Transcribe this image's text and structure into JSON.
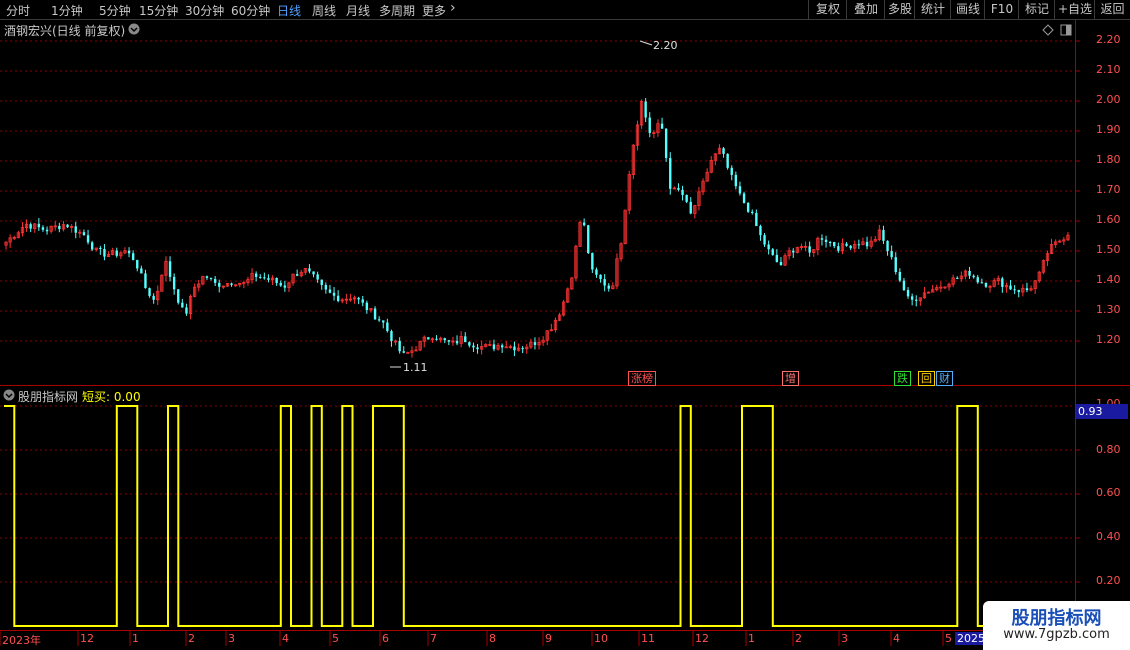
{
  "toolbar": {
    "periods": [
      {
        "label": "分时",
        "active": false
      },
      {
        "label": "1分钟",
        "active": false
      },
      {
        "label": "5分钟",
        "active": false
      },
      {
        "label": "15分钟",
        "active": false
      },
      {
        "label": "30分钟",
        "active": false
      },
      {
        "label": "60分钟",
        "active": false
      },
      {
        "label": "日线",
        "active": true
      },
      {
        "label": "周线",
        "active": false
      },
      {
        "label": "月线",
        "active": false
      },
      {
        "label": "多周期",
        "active": false
      },
      {
        "label": "更多",
        "active": false
      }
    ],
    "more_arrow": "›",
    "right_buttons": [
      "复权",
      "叠加",
      "多股",
      "统计",
      "画线",
      "F10",
      "标记",
      "+自选",
      "返回"
    ]
  },
  "price_panel": {
    "title": "酒钢宏兴(日线 前复权)",
    "y_axis_labels": [
      "2.20",
      "2.10",
      "2.00",
      "1.90",
      "1.80",
      "1.70",
      "1.60",
      "1.50",
      "1.40",
      "1.30",
      "1.20"
    ],
    "high_label": "2.20",
    "low_label": "1.11",
    "events": [
      "涨榜",
      "增",
      "跌",
      "回",
      "财"
    ]
  },
  "indicator_panel": {
    "name": "股朋指标网",
    "series_label": "短买: 0.00",
    "y_axis_labels": [
      "1.00",
      "0.80",
      "0.60",
      "0.40",
      "0.20"
    ],
    "current_value": "0.93"
  },
  "date_axis": {
    "labels": [
      "2023年",
      "12",
      "1",
      "2",
      "3",
      "4",
      "5",
      "6",
      "7",
      "8",
      "9",
      "10",
      "11",
      "12",
      "1",
      "2",
      "3",
      "4",
      "5",
      "2025/"
    ]
  },
  "watermark": {
    "title": "股朋指标网",
    "url": "www.7gpzb.com"
  },
  "colors": {
    "up": "#ff3232",
    "down": "#54ffff",
    "line": "#ffff00",
    "axis": "#aa0000",
    "grid": "#8c0000"
  },
  "chart_data": [
    {
      "type": "candlestick",
      "title": "酒钢宏兴(日线 前复权)",
      "ylim": [
        1.11,
        2.2
      ],
      "y_ticks": [
        1.2,
        1.3,
        1.4,
        1.5,
        1.6,
        1.7,
        1.8,
        1.9,
        2.0,
        2.1,
        2.2
      ],
      "annotations": [
        {
          "label": "2.20",
          "type": "high"
        },
        {
          "label": "1.11",
          "type": "low"
        }
      ],
      "close_path": [
        1.53,
        1.56,
        1.59,
        1.58,
        1.57,
        1.58,
        1.59,
        1.57,
        1.55,
        1.5,
        1.49,
        1.49,
        1.5,
        1.47,
        1.38,
        1.33,
        1.47,
        1.37,
        1.28,
        1.38,
        1.42,
        1.39,
        1.39,
        1.4,
        1.39,
        1.42,
        1.41,
        1.4,
        1.38,
        1.42,
        1.44,
        1.41,
        1.37,
        1.35,
        1.34,
        1.35,
        1.32,
        1.29,
        1.26,
        1.2,
        1.15,
        1.17,
        1.2,
        1.22,
        1.2,
        1.19,
        1.21,
        1.19,
        1.18,
        1.18,
        1.19,
        1.18,
        1.18,
        1.19,
        1.21,
        1.25,
        1.31,
        1.42,
        1.63,
        1.43,
        1.4,
        1.37,
        1.54,
        1.82,
        2.0,
        1.88,
        1.93,
        1.7,
        1.7,
        1.62,
        1.7,
        1.8,
        1.84,
        1.75,
        1.68,
        1.63,
        1.55,
        1.49,
        1.45,
        1.5,
        1.52,
        1.49,
        1.55,
        1.53,
        1.51,
        1.52,
        1.53,
        1.52,
        1.56,
        1.49,
        1.41,
        1.33,
        1.35,
        1.37,
        1.38,
        1.4,
        1.41,
        1.43,
        1.4,
        1.39,
        1.4,
        1.38,
        1.37,
        1.37,
        1.41,
        1.5,
        1.53,
        1.56
      ]
    },
    {
      "type": "line",
      "title": "股朋指标网",
      "series": [
        {
          "name": "短买",
          "values": [
            1,
            0,
            0,
            0,
            0,
            0,
            0,
            0,
            0,
            0,
            0,
            1,
            1,
            0,
            0,
            0,
            1,
            0,
            0,
            0,
            0,
            0,
            0,
            0,
            0,
            0,
            0,
            1,
            0,
            0,
            1,
            0,
            0,
            1,
            0,
            0,
            1,
            1,
            1,
            0,
            0,
            0,
            0,
            0,
            0,
            0,
            0,
            0,
            0,
            0,
            0,
            0,
            0,
            0,
            0,
            0,
            0,
            0,
            0,
            0,
            0,
            0,
            0,
            0,
            0,
            0,
            1,
            0,
            0,
            0,
            0,
            0,
            1,
            1,
            1,
            0,
            0,
            0,
            0,
            0,
            0,
            0,
            0,
            0,
            0,
            0,
            0,
            0,
            0,
            0,
            0,
            0,
            0,
            1,
            1,
            0,
            0,
            0,
            0,
            0,
            0,
            0,
            0,
            0
          ]
        }
      ],
      "ylim": [
        0,
        1
      ],
      "y_ticks": [
        0.2,
        0.4,
        0.6,
        0.8,
        1.0
      ]
    }
  ]
}
